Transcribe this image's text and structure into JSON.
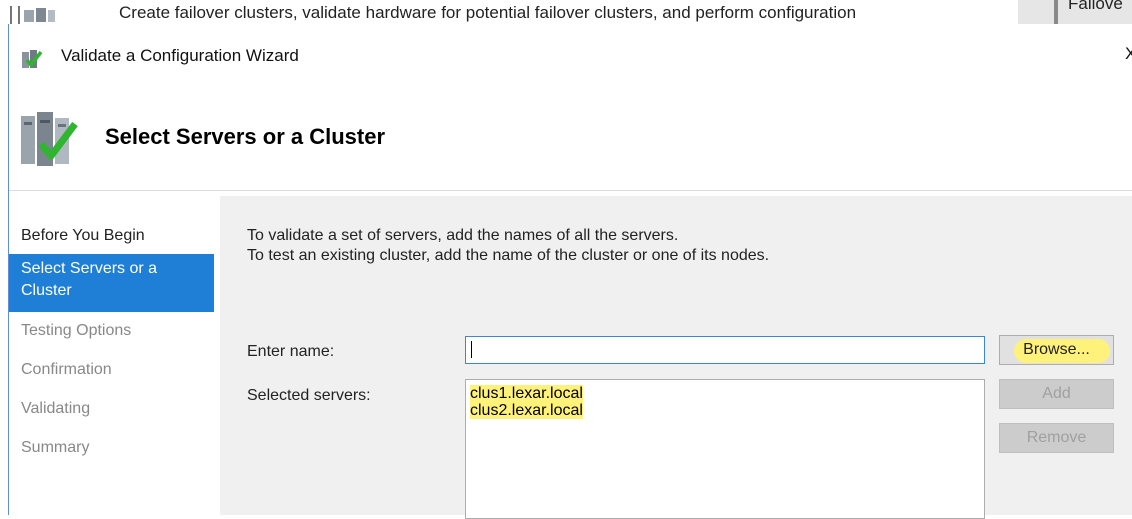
{
  "background_window": {
    "description_text": "Create failover clusters, validate hardware for potential failover clusters, and perform configuration",
    "right_cut_text": "Failove"
  },
  "wizard": {
    "window_title": "Validate a Configuration Wizard",
    "close_glyph": "X",
    "page_title": "Select Servers or a Cluster",
    "nav_items": [
      {
        "label": "Before You Begin",
        "state": "done"
      },
      {
        "label": "Select Servers or a Cluster",
        "state": "current"
      },
      {
        "label": "Testing Options",
        "state": "pending"
      },
      {
        "label": "Confirmation",
        "state": "pending"
      },
      {
        "label": "Validating",
        "state": "pending"
      },
      {
        "label": "Summary",
        "state": "pending"
      }
    ],
    "instructions": [
      "To validate a set of servers, add the names of all the servers.",
      "To test an existing cluster, add the name of the cluster or one of its nodes."
    ],
    "enter_name_label": "Enter name:",
    "enter_name_value": "",
    "selected_servers_label": "Selected servers:",
    "selected_servers": [
      "clus1.lexar.local",
      "clus2.lexar.local"
    ],
    "buttons": {
      "browse": "Browse...",
      "add": "Add",
      "remove": "Remove"
    }
  },
  "colors": {
    "selection_blue": "#1f7fd6",
    "highlight_yellow": "#fff27a",
    "content_bg": "#f0f0f0"
  }
}
